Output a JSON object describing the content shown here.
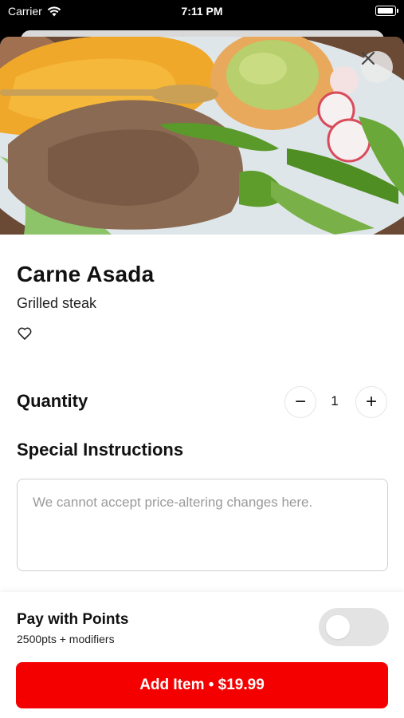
{
  "status_bar": {
    "carrier": "Carrier",
    "time": "7:11 PM",
    "wifi_icon": "wifi-icon",
    "battery_icon": "battery-icon"
  },
  "item": {
    "name": "Carne Asada",
    "description": "Grilled steak",
    "image_alt": "plate of carne asada with rice, beans, guacamole, grilled peppers and radishes",
    "favorite_icon": "heart-icon"
  },
  "quantity": {
    "label": "Quantity",
    "value": "1",
    "decrement_label": "−",
    "increment_label": "+"
  },
  "special_instructions": {
    "label": "Special Instructions",
    "placeholder": "We cannot accept price-altering changes here.",
    "value": ""
  },
  "points": {
    "title": "Pay with Points",
    "subtitle": "2500pts + modifiers",
    "enabled": false
  },
  "add_button": {
    "label": "Add Item • $19.99"
  },
  "colors": {
    "accent": "#f50000",
    "toggle_off": "#e3e3e3"
  }
}
